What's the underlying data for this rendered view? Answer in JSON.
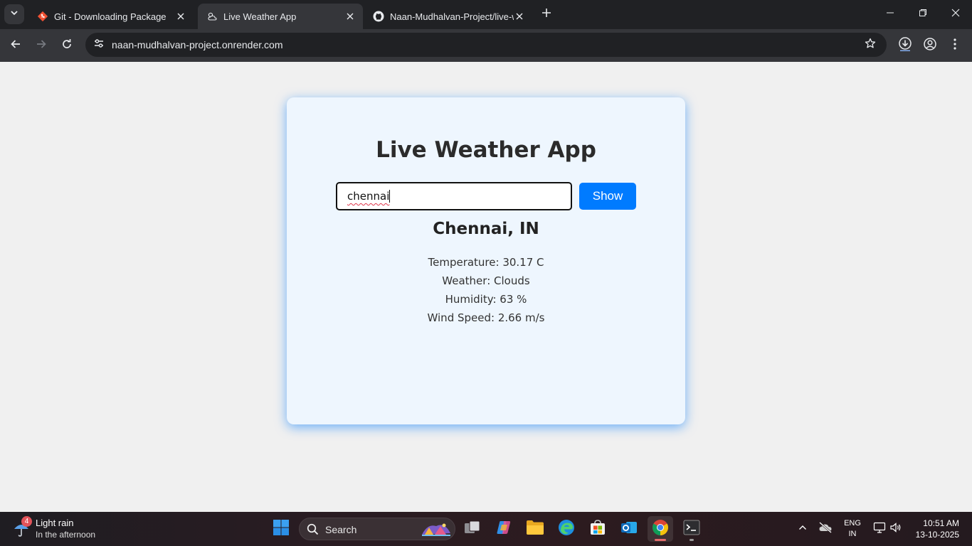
{
  "browser": {
    "tabs": [
      {
        "title": "Git - Downloading Package",
        "active": false,
        "favicon": "git-logo"
      },
      {
        "title": "Live Weather App",
        "active": true,
        "favicon": "cloud-sun-icon"
      },
      {
        "title": "Naan-Mudhalvan-Project/live-w",
        "active": false,
        "favicon": "github-logo"
      }
    ],
    "url": "naan-mudhalvan-project.onrender.com"
  },
  "app": {
    "title": "Live Weather App",
    "search": {
      "value": "chennai",
      "button_label": "Show"
    },
    "result": {
      "city": "Chennai, IN",
      "temperature": "Temperature: 30.17 C",
      "weather": "Weather: Clouds",
      "humidity": "Humidity: 63 %",
      "wind": "Wind Speed: 2.66 m/s"
    },
    "colors": {
      "accent": "#007bff",
      "card_bg": "#eef6fe",
      "page_bg": "#f0f0f0"
    }
  },
  "taskbar": {
    "weather": {
      "badge": "4",
      "line1": "Light rain",
      "line2": "In the afternoon"
    },
    "search_label": "Search",
    "language": {
      "line1": "ENG",
      "line2": "IN"
    },
    "clock": {
      "time": "10:51 AM",
      "date": "13-10-2025"
    }
  }
}
